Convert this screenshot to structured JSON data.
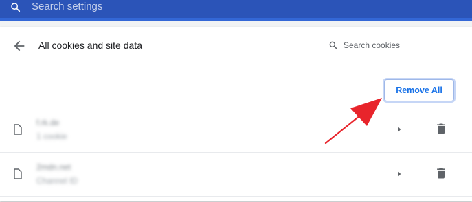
{
  "topbar": {
    "search_placeholder": "Search settings"
  },
  "header": {
    "title": "All cookies and site data",
    "search_placeholder": "Search cookies"
  },
  "actions": {
    "remove_all_label": "Remove All"
  },
  "rows": [
    {
      "site": "f.rk.de",
      "desc": "1 cookie"
    },
    {
      "site": "2mdn.net",
      "desc": "Channel ID"
    }
  ],
  "colors": {
    "topbar": "#2b54b8",
    "accent": "#1a73e8",
    "annotation_arrow": "#e8242b"
  }
}
